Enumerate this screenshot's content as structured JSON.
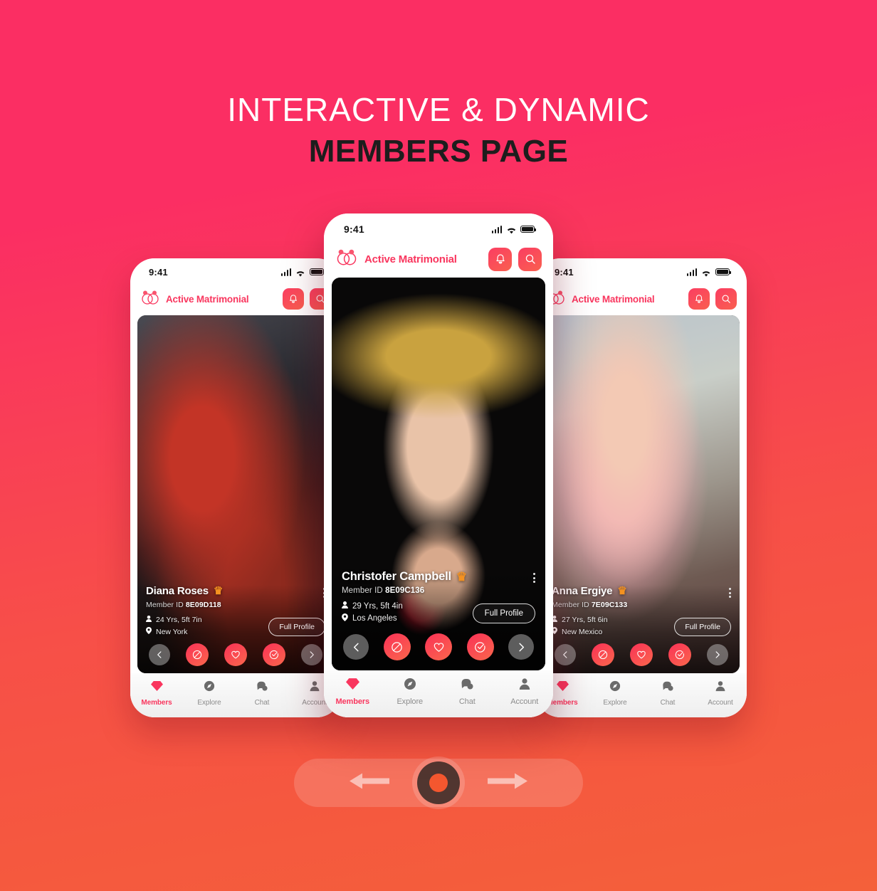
{
  "headline": {
    "line1": "INTERACTIVE & DYNAMIC",
    "line2": "MEMBERS PAGE"
  },
  "colors": {
    "brand_pink": "#F9365E",
    "gradient_top": "#FB2E63",
    "gradient_bottom": "#F4603A",
    "crown_gold": "#F59220",
    "nav_inactive": "#8C8C8C"
  },
  "app": {
    "status_bar": {
      "time": "9:41",
      "signal_icon": "signal-bars-icon",
      "wifi_icon": "wifi-icon",
      "battery_icon": "battery-icon"
    },
    "header": {
      "logo_icon": "interlocking-rings-icon",
      "brand_name": "Active Matrimonial",
      "notification_icon": "bell-icon",
      "search_icon": "search-icon"
    },
    "card_actions": {
      "prev_icon": "chevron-left-icon",
      "reject_icon": "block-icon",
      "like_icon": "heart-icon",
      "accept_icon": "check-circle-icon",
      "next_icon": "chevron-right-icon",
      "menu_icon": "more-vertical-icon",
      "full_profile_label": "Full Profile",
      "crown_icon": "crown-icon",
      "person_icon": "person-icon",
      "location_icon": "map-pin-icon"
    },
    "bottom_nav": [
      {
        "label": "Members",
        "icon": "diamond-icon",
        "active": true
      },
      {
        "label": "Explore",
        "icon": "compass-icon",
        "active": false
      },
      {
        "label": "Chat",
        "icon": "chat-bubble-icon",
        "active": false
      },
      {
        "label": "Account",
        "icon": "person-icon",
        "active": false
      }
    ],
    "member_id_label": "Member ID"
  },
  "profiles": {
    "left": {
      "name": "Diana Roses",
      "member_id": "8E09D118",
      "age_height": "24 Yrs, 5ft 7in",
      "location": "New York",
      "photo_description": "woman in red coat with shopping bags"
    },
    "center": {
      "name": "Christofer Campbell",
      "member_id": "8E09C136",
      "age_height": "29 Yrs, 5ft 4in",
      "location": "Los Angeles",
      "photo_description": "woman wearing jeweled crown on black background"
    },
    "right": {
      "name": "Anna Ergiye",
      "member_id": "7E09C133",
      "age_height": "27 Yrs, 5ft 6in",
      "location": "New Mexico",
      "photo_description": "blonde woman in pink top leaning on table"
    }
  },
  "carousel": {
    "prev_icon": "arrow-left-icon",
    "record_icon": "record-dot-icon",
    "next_icon": "arrow-right-icon"
  }
}
